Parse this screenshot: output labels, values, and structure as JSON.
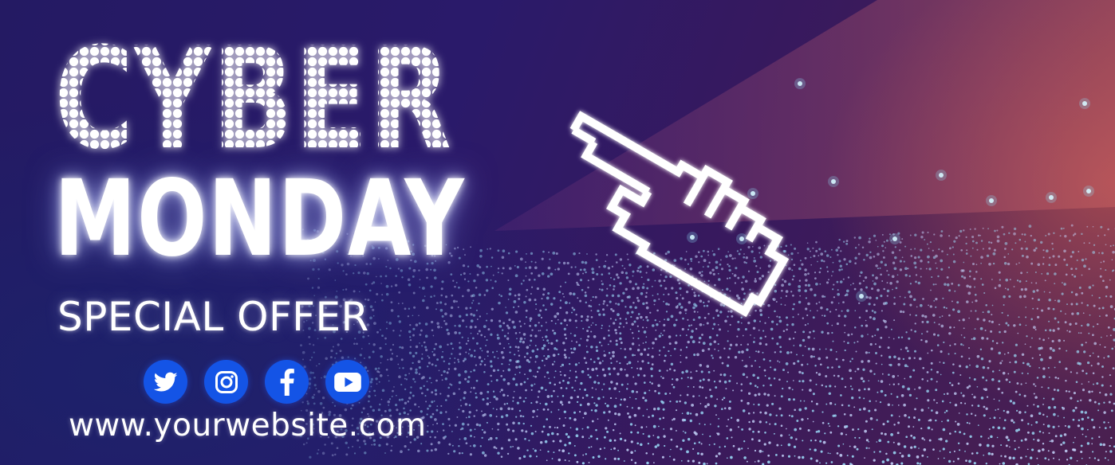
{
  "headline": {
    "cyber": "CYBER",
    "monday": "MONDAY",
    "subtitle": "SPECIAL OFFER"
  },
  "social": [
    {
      "icon": "twitter-icon",
      "label": "Twitter"
    },
    {
      "icon": "instagram-icon",
      "label": "Instagram"
    },
    {
      "icon": "facebook-icon",
      "label": "Facebook"
    },
    {
      "icon": "youtube-icon",
      "label": "YouTube"
    }
  ],
  "website": "www.yourwebsite.com",
  "colors": {
    "background_dark": "#241a63",
    "background_warm": "#c85a50",
    "text": "#ffffff",
    "social_button": "#1454e6"
  },
  "decoration": {
    "pointer": "pixel-hand-cursor-icon",
    "pattern": "particle-wave"
  }
}
